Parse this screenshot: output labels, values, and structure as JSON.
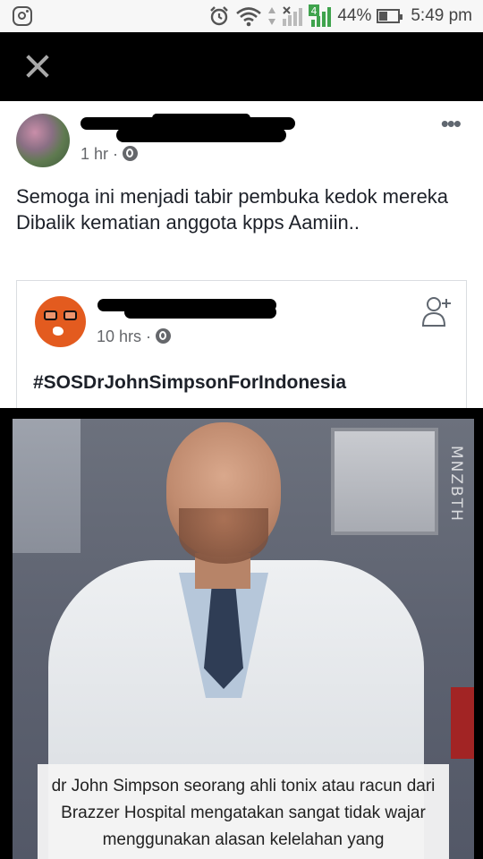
{
  "status_bar": {
    "battery_percent": "44%",
    "battery_level": 0.44,
    "time": "5:49 pm",
    "sim_badge": "4",
    "icons": [
      "instagram-icon",
      "alarm-icon",
      "wifi-icon",
      "signal-icon",
      "battery-icon"
    ]
  },
  "post": {
    "time": "1 hr",
    "separator": "·",
    "text": "Semoga ini menjadi tabir pembuka kedok mereka Dibalik kematian anggota kpps Aamiin.."
  },
  "shared_post": {
    "time": "10 hrs",
    "separator": "·",
    "hashtag": "#SOSDrJohnSimpsonForIndonesia"
  },
  "image": {
    "watermark": "MNZBTH",
    "caption": "dr John Simpson seorang ahli tonix atau racun dari Brazzer Hospital mengatakan sangat tidak wajar menggunakan alasan kelelahan yang"
  }
}
